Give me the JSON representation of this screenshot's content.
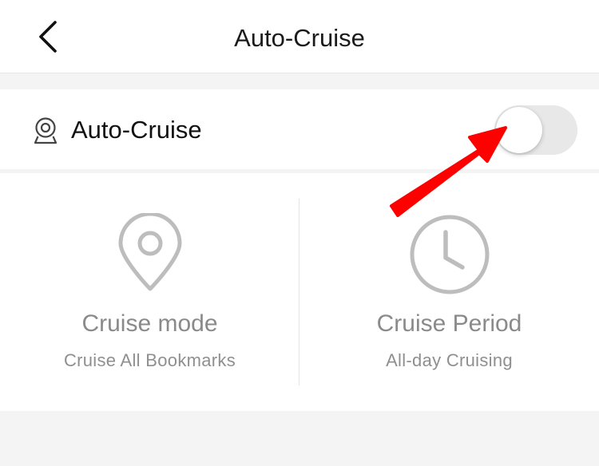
{
  "header": {
    "title": "Auto-Cruise",
    "back_icon": "chevron-left-icon"
  },
  "toggle_row": {
    "label": "Auto-Cruise",
    "icon": "webcam-icon",
    "enabled": false
  },
  "options": [
    {
      "icon": "location-pin-icon",
      "title": "Cruise mode",
      "subtitle": "Cruise All Bookmarks"
    },
    {
      "icon": "clock-icon",
      "title": "Cruise Period",
      "subtitle": "All-day Cruising"
    }
  ],
  "annotation": {
    "type": "arrow",
    "color": "#ff0000",
    "points_to": "auto-cruise-toggle"
  },
  "colors": {
    "background": "#f4f4f4",
    "surface": "#ffffff",
    "switch_off": "#e8e8e8",
    "muted_text": "#8a8a8a",
    "icon_gray": "#bdbdbd"
  }
}
